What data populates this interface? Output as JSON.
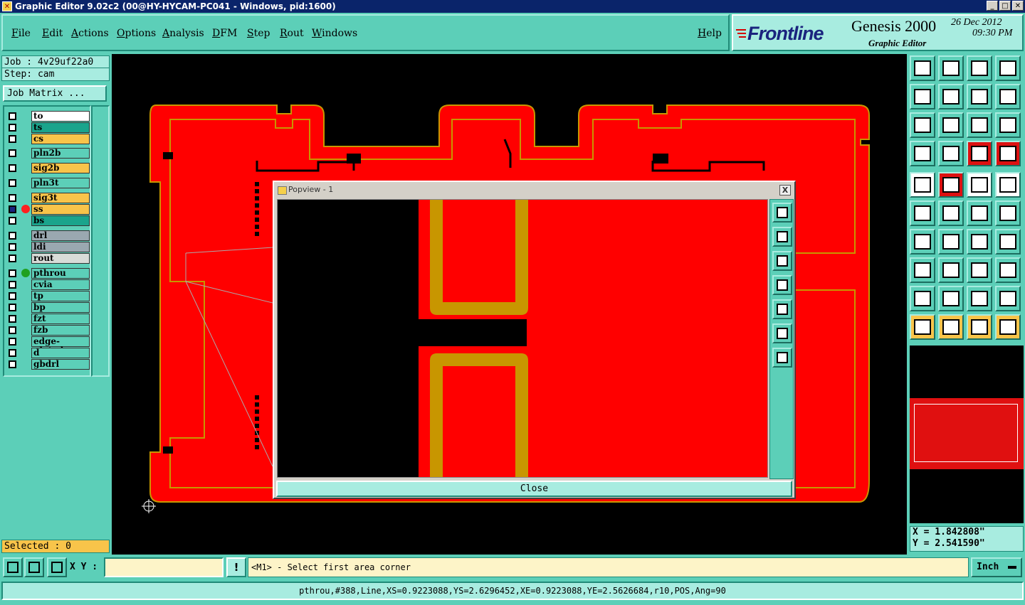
{
  "window": {
    "title": "Graphic Editor 9.02c2 (00@HY-HYCAM-PC041 - Windows, pid:1600)",
    "minimize": "_",
    "maximize": "□",
    "close": "✕"
  },
  "menu": {
    "items": [
      "File",
      "Edit",
      "Actions",
      "Options",
      "Analysis",
      "DFM",
      "Step",
      "Rout",
      "Windows"
    ],
    "help": "Help"
  },
  "brand": {
    "logo": "Frontline",
    "product": "Genesis 2000",
    "subtitle": "Graphic Editor",
    "date": "26 Dec 2012",
    "time": "09:30 PM"
  },
  "job": {
    "job_line": "Job : 4v29uf22a0",
    "step_line": "Step: cam",
    "matrix_button": "Job Matrix ..."
  },
  "layers": [
    {
      "name": "to",
      "color": "#ffffff"
    },
    {
      "name": "ts",
      "color": "#1aa48c"
    },
    {
      "name": "cs",
      "color": "#f8c44a"
    },
    {
      "name": "pln2b",
      "color": "#5ccfb8"
    },
    {
      "name": "sig2b",
      "color": "#f8c44a"
    },
    {
      "name": "pln3t",
      "color": "#5ccfb8"
    },
    {
      "name": "sig3t",
      "color": "#f8c44a"
    },
    {
      "name": "ss",
      "color": "#f8c44a",
      "work": true
    },
    {
      "name": "bs",
      "color": "#1aa48c"
    },
    {
      "name": "drl",
      "color": "#9aa8b0"
    },
    {
      "name": "ldi",
      "color": "#9aa8b0"
    },
    {
      "name": "rout",
      "color": "#d8dcd8"
    },
    {
      "name": "pthrou",
      "color": "#5ccfb8",
      "affected": true
    },
    {
      "name": "cvia",
      "color": "#5ccfb8"
    },
    {
      "name": "tp",
      "color": "#5ccfb8"
    },
    {
      "name": "bp",
      "color": "#5ccfb8"
    },
    {
      "name": "fzt",
      "color": "#5ccfb8"
    },
    {
      "name": "fzb",
      "color": "#5ccfb8"
    },
    {
      "name": "edge-plated",
      "color": "#5ccfb8"
    },
    {
      "name": "d",
      "color": "#5ccfb8"
    },
    {
      "name": "gbdrl",
      "color": "#5ccfb8"
    }
  ],
  "selected": "Selected : 0",
  "popview": {
    "title": "Popview - 1",
    "close_x": "X",
    "close_button": "Close"
  },
  "coords": {
    "x": "X = 1.842808\"",
    "y": "Y = 2.541590\""
  },
  "bottom": {
    "xy_label": "X Y :",
    "xy_value": "",
    "bang": "!",
    "prompt": "<M1> - Select first area corner",
    "units": "Inch"
  },
  "status": "pthrou,#388,Line,XS=0.9223088,YS=2.6296452,XE=0.9223088,YE=2.5626684,r10,POS,Ang=90",
  "colors": {
    "copper": "#ff0000",
    "outline": "#c89600",
    "panel": "#5ccfb8",
    "panel_light": "#a8ece0",
    "highlight": "#f8c44a"
  },
  "tools": [
    "zoom-home-icon",
    "zoom-out-icon",
    "home-icon",
    "window-icon",
    "pan-left-icon",
    "pan-right-icon",
    "undo-icon",
    "redraw-icon",
    "fit-icon",
    "center-icon",
    "scale-1-2-icon",
    "help-icon",
    "tools-icon",
    "grid-icon",
    "snap-icon",
    "snap-active-icon",
    "add-pad-icon",
    "route-icon",
    "measure-icon",
    "circle-icon",
    "connect-icon",
    "delete-icon",
    "move-icon",
    "drag-icon",
    "angle-icon",
    "line-icon",
    "arc-icon",
    "mirror-icon",
    "select-pad-icon",
    "split-icon",
    "stretch-icon",
    "group-icon",
    "triangle-icon",
    "arrow-up-icon",
    "feature-up-icon",
    "feature-down-icon",
    "pointer-icon",
    "select-box-icon",
    "select-net-icon",
    "select-path-icon"
  ]
}
